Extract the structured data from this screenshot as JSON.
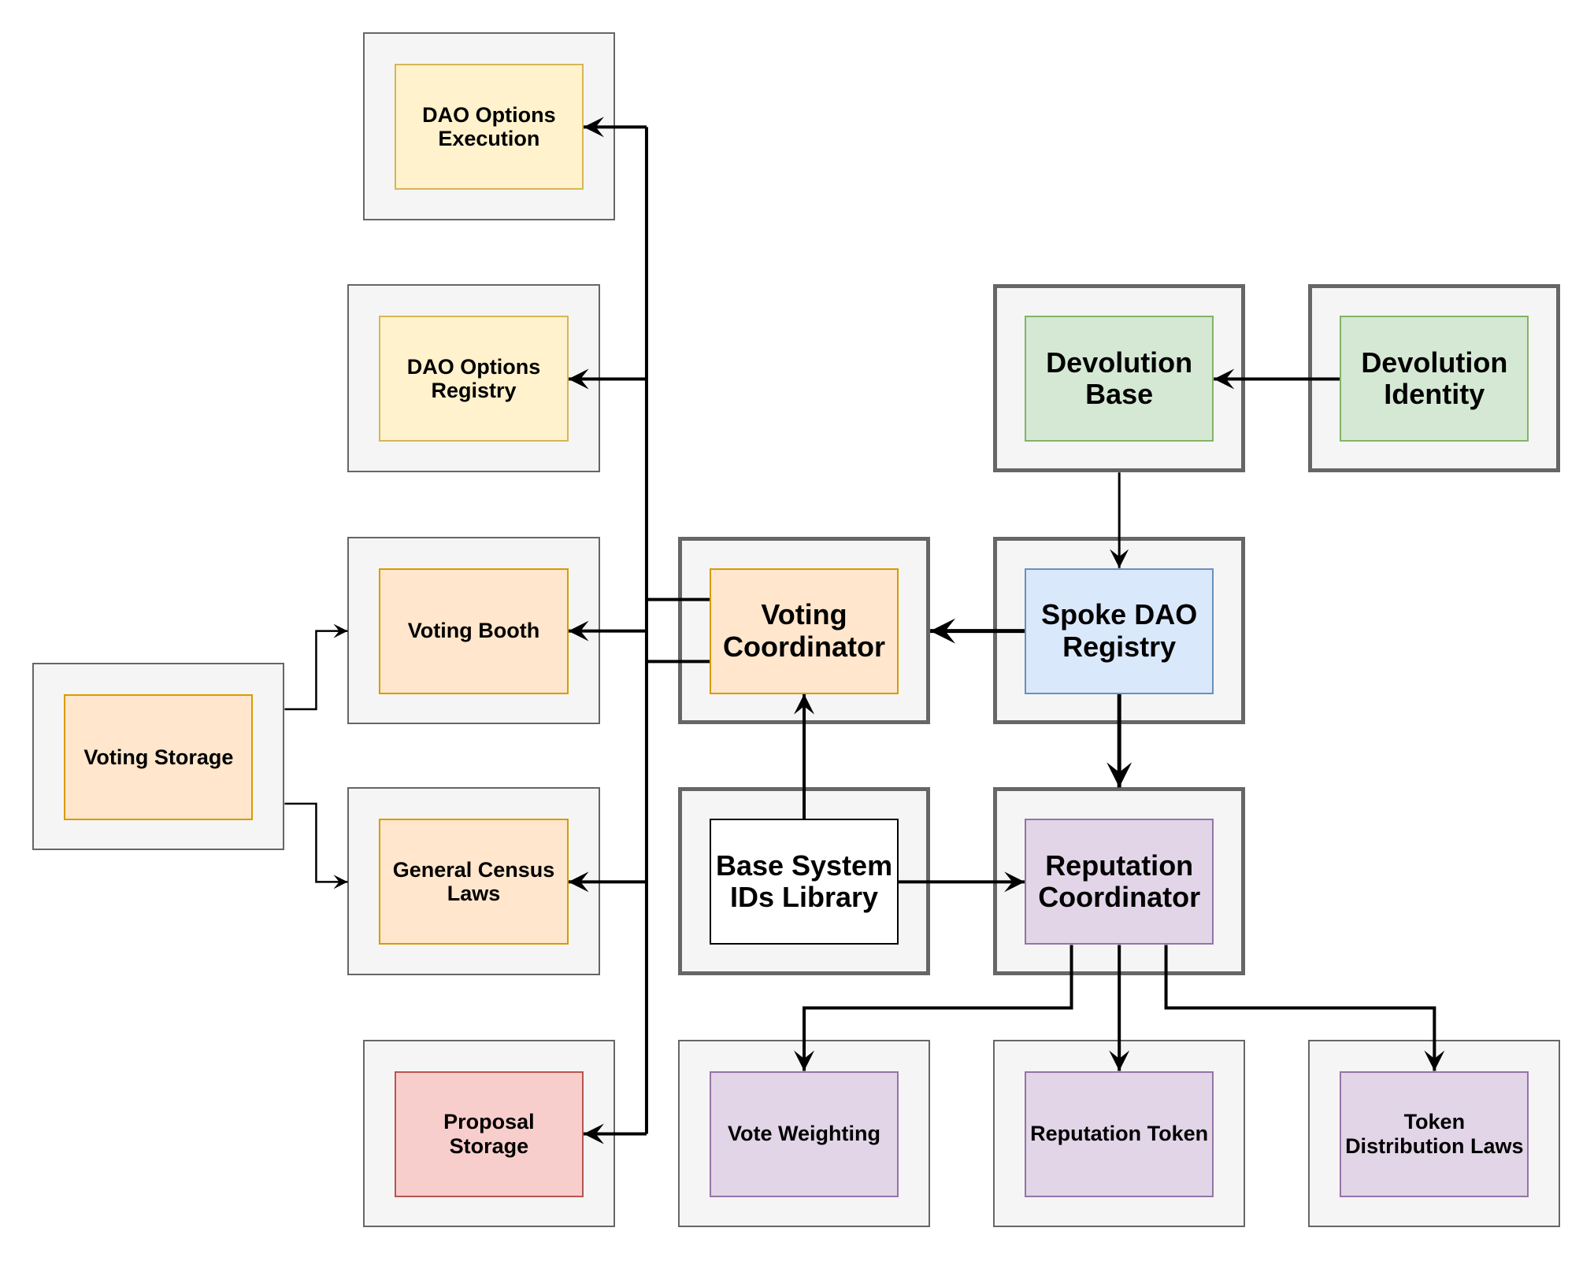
{
  "diagram": {
    "title": "",
    "colors": {
      "container_fill": "#f5f5f5",
      "container_stroke": "#666666",
      "edge": "#000000",
      "yellow_fill": "#fff2cc",
      "yellow_stroke": "#d6b656",
      "orange_fill": "#ffe6cc",
      "orange_stroke": "#d79b00",
      "red_fill": "#f8cecc",
      "red_stroke": "#b85450",
      "green_fill": "#d5e8d4",
      "green_stroke": "#82b366",
      "blue_fill": "#dae8fc",
      "blue_stroke": "#6c8ebf",
      "purple_fill": "#e1d5e7",
      "purple_stroke": "#9673a6",
      "white_fill": "#ffffff",
      "white_stroke": "#000000"
    },
    "nodes": [
      {
        "id": "dao-options-execution",
        "label": "DAO Options Execution",
        "lines": [
          "DAO Options",
          "Execution"
        ],
        "color": "yellow"
      },
      {
        "id": "dao-options-registry",
        "label": "DAO Options Registry",
        "lines": [
          "DAO Options",
          "Registry"
        ],
        "color": "yellow"
      },
      {
        "id": "voting-booth",
        "label": "Voting Booth",
        "lines": [
          "Voting Booth"
        ],
        "color": "orange"
      },
      {
        "id": "general-census-laws",
        "label": "General Census Laws",
        "lines": [
          "General Census",
          "Laws"
        ],
        "color": "orange"
      },
      {
        "id": "proposal-storage",
        "label": "Proposal Storage",
        "lines": [
          "Proposal",
          "Storage"
        ],
        "color": "red"
      },
      {
        "id": "voting-storage",
        "label": "Voting Storage",
        "lines": [
          "Voting Storage"
        ],
        "color": "orange"
      },
      {
        "id": "voting-coordinator",
        "label": "Voting Coordinator",
        "lines": [
          "Voting",
          "Coordinator"
        ],
        "color": "orange",
        "emphasis": true
      },
      {
        "id": "base-system-ids-library",
        "label": "Base System IDs Library",
        "lines": [
          "Base System",
          "IDs Library"
        ],
        "color": "white",
        "emphasis": true
      },
      {
        "id": "devolution-base",
        "label": "Devolution Base",
        "lines": [
          "Devolution",
          "Base"
        ],
        "color": "green",
        "emphasis": true
      },
      {
        "id": "devolution-identity",
        "label": "Devolution Identity",
        "lines": [
          "Devolution",
          "Identity"
        ],
        "color": "green",
        "emphasis": true
      },
      {
        "id": "spoke-dao-registry",
        "label": "Spoke DAO Registry",
        "lines": [
          "Spoke DAO",
          "Registry"
        ],
        "color": "blue",
        "emphasis": true
      },
      {
        "id": "reputation-coordinator",
        "label": "Reputation Coordinator",
        "lines": [
          "Reputation",
          "Coordinator"
        ],
        "color": "purple",
        "emphasis": true
      },
      {
        "id": "vote-weighting",
        "label": "Vote Weighting",
        "lines": [
          "Vote Weighting"
        ],
        "color": "purple"
      },
      {
        "id": "reputation-token",
        "label": "Reputation Token",
        "lines": [
          "Reputation Token"
        ],
        "color": "purple"
      },
      {
        "id": "token-distribution-laws",
        "label": "Token Distribution Laws",
        "lines": [
          "Token",
          "Distribution Laws"
        ],
        "color": "purple"
      }
    ],
    "edges": [
      {
        "from": "devolution-identity",
        "to": "devolution-base"
      },
      {
        "from": "devolution-base",
        "to": "spoke-dao-registry"
      },
      {
        "from": "spoke-dao-registry",
        "to": "voting-coordinator"
      },
      {
        "from": "spoke-dao-registry",
        "to": "reputation-coordinator"
      },
      {
        "from": "base-system-ids-library",
        "to": "voting-coordinator"
      },
      {
        "from": "base-system-ids-library",
        "to": "reputation-coordinator"
      },
      {
        "from": "voting-coordinator",
        "to": "dao-options-execution"
      },
      {
        "from": "voting-coordinator",
        "to": "dao-options-registry"
      },
      {
        "from": "voting-coordinator",
        "to": "voting-booth"
      },
      {
        "from": "voting-coordinator",
        "to": "general-census-laws"
      },
      {
        "from": "voting-coordinator",
        "to": "proposal-storage"
      },
      {
        "from": "voting-storage",
        "to": "voting-booth"
      },
      {
        "from": "voting-storage",
        "to": "general-census-laws"
      },
      {
        "from": "reputation-coordinator",
        "to": "vote-weighting"
      },
      {
        "from": "reputation-coordinator",
        "to": "reputation-token"
      },
      {
        "from": "reputation-coordinator",
        "to": "token-distribution-laws"
      }
    ]
  }
}
